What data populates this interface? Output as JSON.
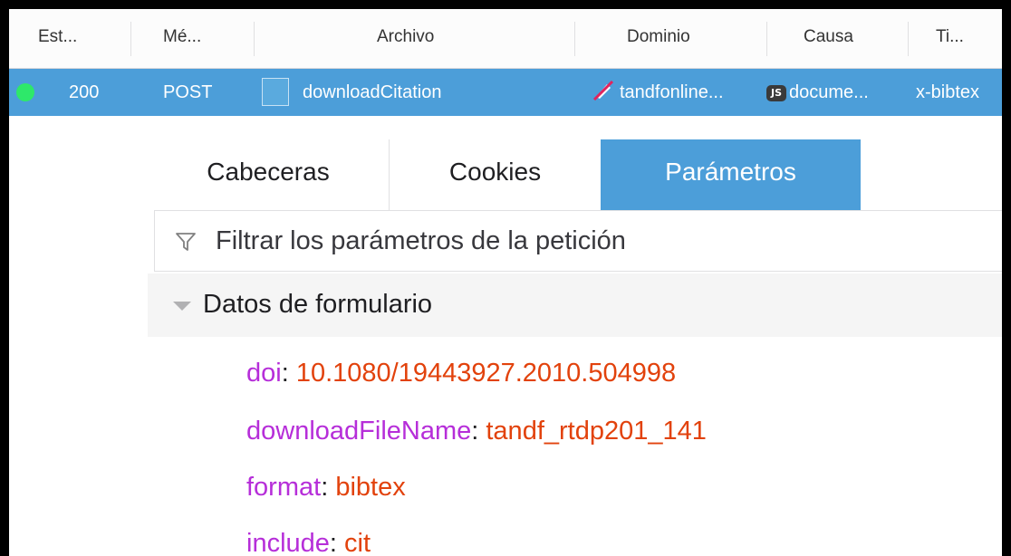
{
  "columns": {
    "status": "Est...",
    "method": "Mé...",
    "file": "Archivo",
    "domain": "Dominio",
    "cause": "Causa",
    "type": "Ti..."
  },
  "request": {
    "status": "200",
    "method": "POST",
    "file": "downloadCitation",
    "domain": "tandfonline...",
    "cause_badge": "JS",
    "cause": "docume...",
    "type": "x-bibtex",
    "status_color": "#2ee86a",
    "row_color": "#4c9ed9"
  },
  "tabs": {
    "headers": "Cabeceras",
    "cookies": "Cookies",
    "params": "Parámetros"
  },
  "filter": {
    "placeholder": "Filtrar los parámetros de la petición"
  },
  "section": {
    "title": "Datos de formulario"
  },
  "params": [
    {
      "key": "doi",
      "value": "10.1080/19443927.2010.504998"
    },
    {
      "key": "downloadFileName",
      "value": "tandf_rtdp201_141"
    },
    {
      "key": "format",
      "value": "bibtex"
    },
    {
      "key": "include",
      "value": "cit"
    }
  ]
}
